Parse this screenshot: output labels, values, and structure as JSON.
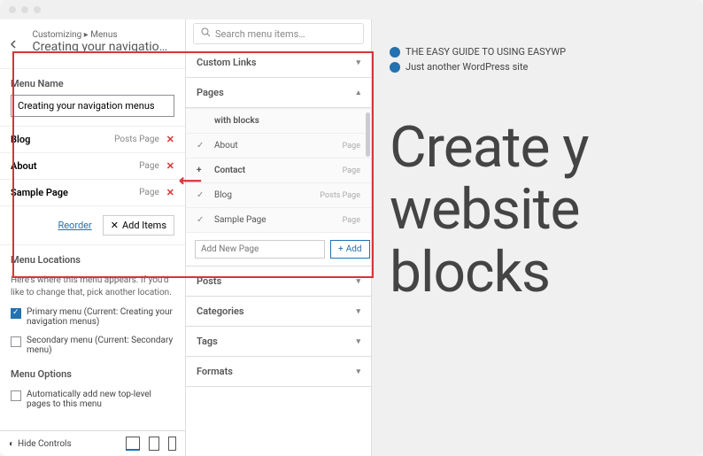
{
  "breadcrumb": "Customizing ▸ Menus",
  "panel_title": "Creating your navigatio…",
  "section_menu_name": "Menu Name",
  "menu_name_value": "Creating your navigation menus",
  "menu_items": [
    {
      "label": "Blog",
      "type": "Posts Page"
    },
    {
      "label": "About",
      "type": "Page"
    },
    {
      "label": "Sample Page",
      "type": "Page"
    }
  ],
  "link_reorder": "Reorder",
  "btn_add_items": "Add Items",
  "section_locations": "Menu Locations",
  "locations_help": "Here's where this menu appears. If you'd like to change that, pick another location.",
  "loc_primary": "Primary menu (Current: Creating your navigation menus)",
  "loc_secondary": "Secondary menu (Current: Secondary menu)",
  "section_options": "Menu Options",
  "opt_auto_add": "Automatically add new top-level pages to this menu",
  "hide_controls": "Hide Controls",
  "search_placeholder": "Search menu items…",
  "acc_custom": "Custom Links",
  "acc_pages": "Pages",
  "page_header_partial": "with blocks",
  "pages": [
    {
      "name": "About",
      "type": "Page",
      "sel": "check"
    },
    {
      "name": "Contact",
      "type": "Page",
      "sel": "plus"
    },
    {
      "name": "Blog",
      "type": "Posts Page",
      "sel": "check"
    },
    {
      "name": "Sample Page",
      "type": "Page",
      "sel": "check"
    }
  ],
  "add_new_placeholder": "Add New Page",
  "add_btn": "Add",
  "acc_posts": "Posts",
  "acc_categories": "Categories",
  "acc_tags": "Tags",
  "acc_formats": "Formats",
  "preview_title": "THE EASY GUIDE TO USING EASYWP",
  "preview_sub": "Just another WordPress site",
  "hero_l1": "Create y",
  "hero_l2": "website",
  "hero_l3": "blocks"
}
